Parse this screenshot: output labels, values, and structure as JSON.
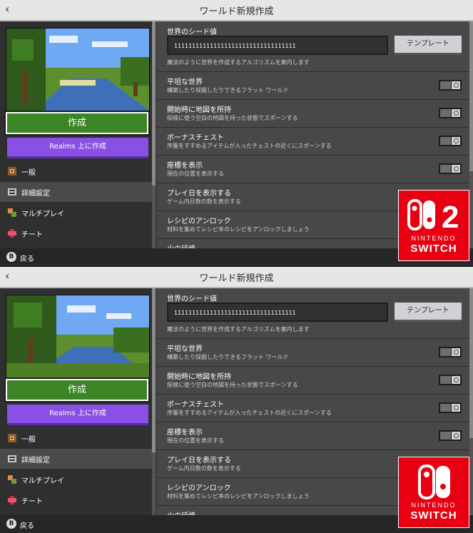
{
  "screens": [
    {
      "variant": "Nintendo Switch 2",
      "title": "ワールド新規作成",
      "back_glyph": "‹",
      "left_panel": {
        "create_label": "作成",
        "realms_label": "Realms 上に作成",
        "nav": [
          {
            "label": "一般",
            "icon": "gear-icon",
            "active": false
          },
          {
            "label": "詳細設定",
            "icon": "settings-icon",
            "active": true
          },
          {
            "label": "マルチプレイ",
            "icon": "multiplayer-icon",
            "active": false
          },
          {
            "label": "チート",
            "icon": "cheats-icon",
            "active": false
          }
        ]
      },
      "seed": {
        "title": "世界のシード値",
        "value": "1111111111111111111111111111111111",
        "template_label": "テンプレート",
        "description": "魔法のように世界を作成するアルゴリズムを案内します"
      },
      "settings": [
        {
          "title": "平坦な世界",
          "description": "構築したり採掘したりできるフラット ワールド",
          "on": false
        },
        {
          "title": "開始時に地図を所持",
          "description": "探検に使う空白の地図を持った状態でスポーンする",
          "on": false
        },
        {
          "title": "ボーナスチェスト",
          "description": "序盤をすすめるアイテムが入ったチェストの近くにスポーンする",
          "on": false
        },
        {
          "title": "座標を表示",
          "description": "現在の位置を表示する",
          "on": false
        },
        {
          "title": "プレイ日を表示する",
          "description": "ゲーム内日数の数を表示する",
          "on": false
        },
        {
          "title": "レシピのアンロック",
          "description": "材料を集めてレシピ本のレシピをアンロックしましょう",
          "on": false
        },
        {
          "title": "火の延焼",
          "description": "",
          "on": false
        }
      ],
      "bottom": {
        "button_glyph": "B",
        "label": "戻る"
      },
      "badge": {
        "nintendo": "NINTENDO",
        "switch": "SWITCH",
        "logo": "switch-2-logo",
        "logo_text": "2"
      }
    },
    {
      "variant": "Nintendo Switch",
      "title": "ワールド新規作成",
      "back_glyph": "‹",
      "left_panel": {
        "create_label": "作成",
        "realms_label": "Realms 上に作成",
        "nav": [
          {
            "label": "一般",
            "icon": "gear-icon",
            "active": false
          },
          {
            "label": "詳細設定",
            "icon": "settings-icon",
            "active": true
          },
          {
            "label": "マルチプレイ",
            "icon": "multiplayer-icon",
            "active": false
          },
          {
            "label": "チート",
            "icon": "cheats-icon",
            "active": false
          }
        ]
      },
      "seed": {
        "title": "世界のシード値",
        "value": "1111111111111111111111111111111111",
        "template_label": "テンプレート",
        "description": "魔法のように世界を作成するアルゴリズムを案内します"
      },
      "settings": [
        {
          "title": "平坦な世界",
          "description": "構築したり採掘したりできるフラット ワールド",
          "on": false
        },
        {
          "title": "開始時に地図を所持",
          "description": "探検に使う空白の地図を持った状態でスポーンする",
          "on": false
        },
        {
          "title": "ボーナスチェスト",
          "description": "序盤をすすめるアイテムが入ったチェストの近くにスポーンする",
          "on": false
        },
        {
          "title": "座標を表示",
          "description": "現在の位置を表示する",
          "on": false
        },
        {
          "title": "プレイ日を表示する",
          "description": "ゲーム内日数の数を表示する",
          "on": false
        },
        {
          "title": "レシピのアンロック",
          "description": "材料を集めてレシピ本のレシピをアンロックしましょう",
          "on": false
        },
        {
          "title": "火の延焼",
          "description": "",
          "on": false
        }
      ],
      "bottom": {
        "button_glyph": "B",
        "label": "戻る"
      },
      "badge": {
        "nintendo": "NINTENDO",
        "switch": "SWITCH",
        "logo": "switch-logo"
      }
    }
  ],
  "colors": {
    "create_button": "#3c8527",
    "realms_button": "#8a4fe4",
    "titlebar": "#e6e6e6",
    "panel": "#484848",
    "badge": "#e60012"
  }
}
